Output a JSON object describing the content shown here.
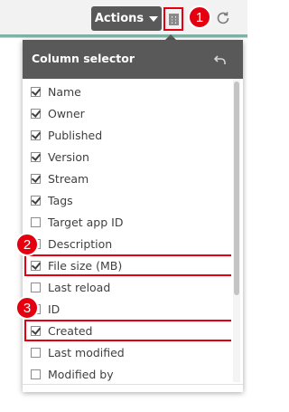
{
  "toolbar": {
    "actions_label": "Actions",
    "column_toggle_icon": "table-columns-icon",
    "refresh_icon": "refresh-icon"
  },
  "callouts": {
    "one": "1",
    "two": "2",
    "three": "3"
  },
  "column_selector": {
    "title": "Column selector",
    "reset_icon": "undo-icon",
    "items": [
      {
        "label": "Name",
        "checked": true
      },
      {
        "label": "Owner",
        "checked": true
      },
      {
        "label": "Published",
        "checked": true
      },
      {
        "label": "Version",
        "checked": true
      },
      {
        "label": "Stream",
        "checked": true
      },
      {
        "label": "Tags",
        "checked": true
      },
      {
        "label": "Target app ID",
        "checked": false
      },
      {
        "label": "Description",
        "checked": false
      },
      {
        "label": "File size (MB)",
        "checked": true
      },
      {
        "label": "Last reload",
        "checked": false
      },
      {
        "label": "ID",
        "checked": false
      },
      {
        "label": "Created",
        "checked": true
      },
      {
        "label": "Last modified",
        "checked": false
      },
      {
        "label": "Modified by",
        "checked": false
      }
    ]
  },
  "colors": {
    "accent_red": "#e4000f",
    "header_gray": "#595959",
    "teal_bar": "#7fb1a4"
  }
}
